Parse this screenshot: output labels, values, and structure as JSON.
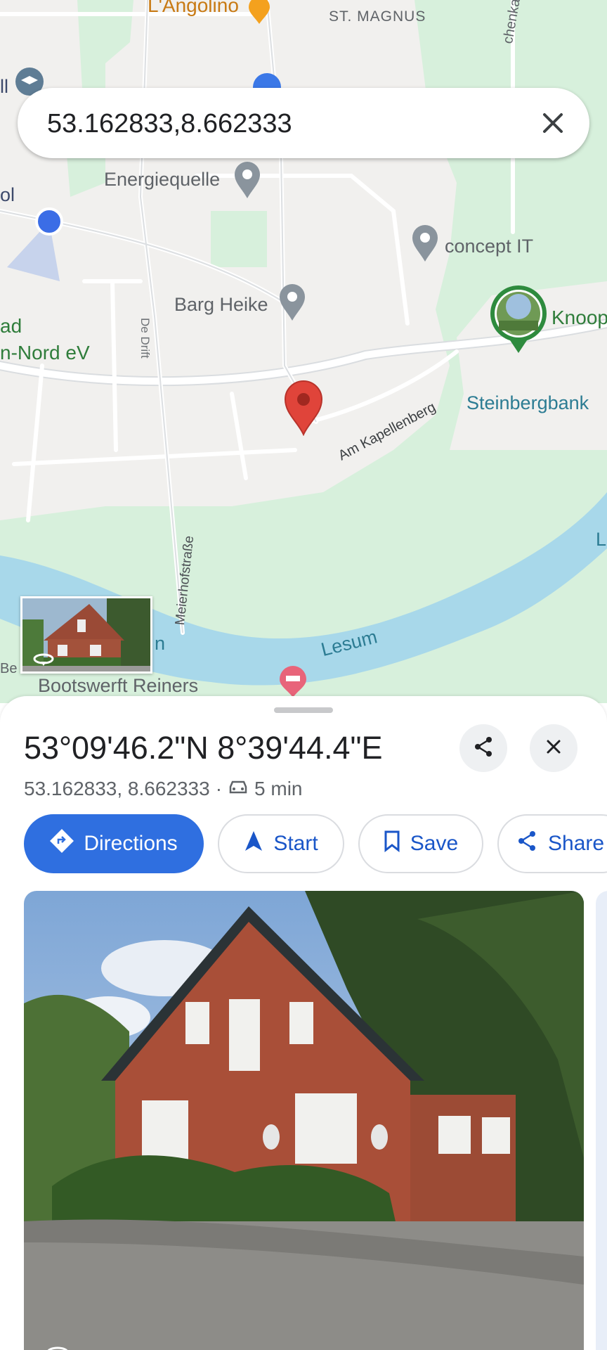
{
  "search": {
    "query": "53.162833,8.662333"
  },
  "map": {
    "labels": {
      "langolino": "L'Angolino",
      "st_magnus": "ST. MAGNUS",
      "chenkamps": "chenkampsw",
      "energiequelle": "Energiequelle",
      "concept_it": "concept IT",
      "barg_heike": "Barg Heike",
      "knoop": "Knoop",
      "steinbergbank": "Steinbergbank",
      "de_drift": "De Drift",
      "am_kapellenberg": "Am Kapellenberg",
      "meierhofstrasse": "Meierhofstraße",
      "lesum": "Lesum",
      "bootswerft": "Bootswerft Reiners",
      "ol": "ol",
      "ll": "ll",
      "ad": "ad",
      "n_nord": "n-Nord eV",
      "be": "Be",
      "river_l": "L",
      "river_n": "n"
    }
  },
  "place": {
    "title": "53°09'46.2\"N 8°39'44.4\"E",
    "coords": "53.162833, 8.662333",
    "separator": "·",
    "drive_time": "5 min"
  },
  "actions": {
    "directions": "Directions",
    "start": "Start",
    "save": "Save",
    "share": "Share"
  },
  "colors": {
    "accent": "#2f6fe0",
    "pin_red": "#e0443a",
    "water": "#a8d8ea",
    "park": "#d7f0dc"
  }
}
